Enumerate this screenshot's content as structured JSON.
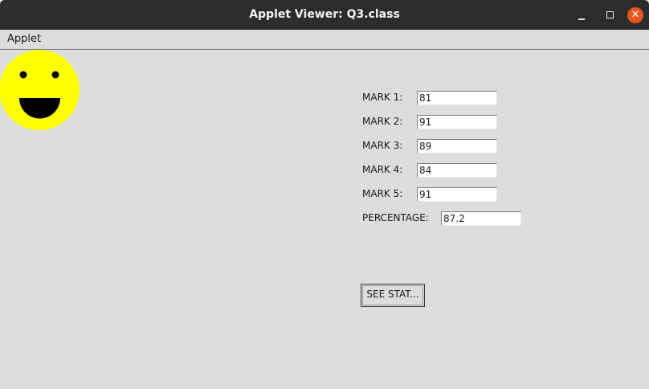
{
  "window": {
    "title": "Applet Viewer: Q3.class",
    "close_glyph": "✕"
  },
  "menubar": {
    "items": [
      "Applet"
    ]
  },
  "smiley": {
    "icon": "smiley-face-icon",
    "face_color": "#ffff00",
    "feature_color": "#000000"
  },
  "form": {
    "marks": [
      {
        "label": "MARK 1:",
        "value": "81"
      },
      {
        "label": "MARK 2:",
        "value": "91"
      },
      {
        "label": "MARK 3:",
        "value": "89"
      },
      {
        "label": "MARK 4:",
        "value": "84"
      },
      {
        "label": "MARK 5:",
        "value": "91"
      }
    ],
    "percentage": {
      "label": "PERCENTAGE:",
      "value": "87.2"
    },
    "button_label": "SEE STAT..."
  },
  "colors": {
    "titlebar": "#2c2c2c",
    "background": "#dddddd",
    "close_button": "#e95420"
  }
}
